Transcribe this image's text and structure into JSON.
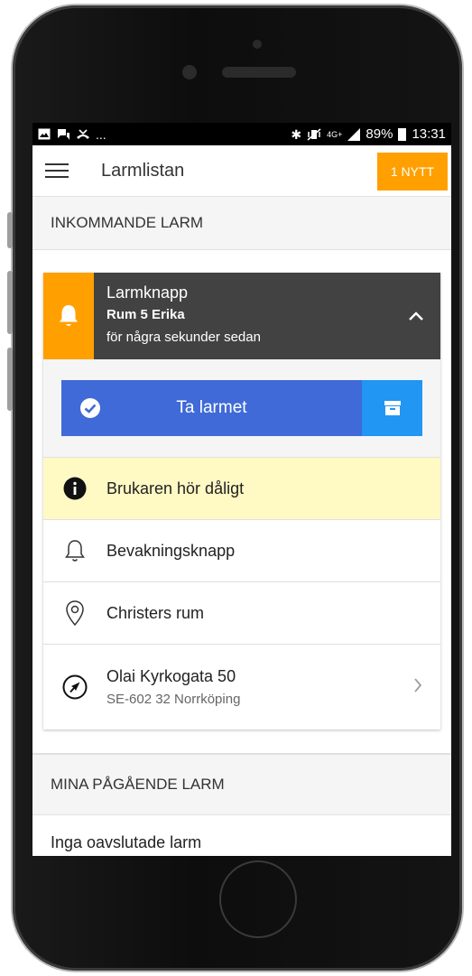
{
  "status_bar": {
    "left_icons": [
      "image-icon",
      "chat-icon",
      "missed-call-icon"
    ],
    "ellipsis": "...",
    "network": "4G+",
    "battery": "89%",
    "time": "13:31"
  },
  "app_bar": {
    "title": "Larmlistan",
    "new_button": "1 NYTT"
  },
  "incoming": {
    "heading": "INKOMMANDE LARM",
    "alarm": {
      "type": "Larmknapp",
      "room": "Rum 5 Erika",
      "time": "för några sekunder sedan",
      "take_label": "Ta larmet",
      "note": "Brukaren hör dåligt",
      "device": "Bevakningsknapp",
      "location": "Christers rum",
      "address_line1": "Olai Kyrkogata 50",
      "address_line2": "SE-602 32 Norrköping"
    }
  },
  "ongoing": {
    "heading": "MINA PÅGÅENDE LARM",
    "empty_text": "Inga oavslutade larm"
  },
  "colors": {
    "accent_orange": "#ffa000",
    "take_blue": "#3f6ad8",
    "archive_blue": "#2196f3",
    "header_dark": "#424242",
    "note_yellow": "#fff9c4"
  }
}
